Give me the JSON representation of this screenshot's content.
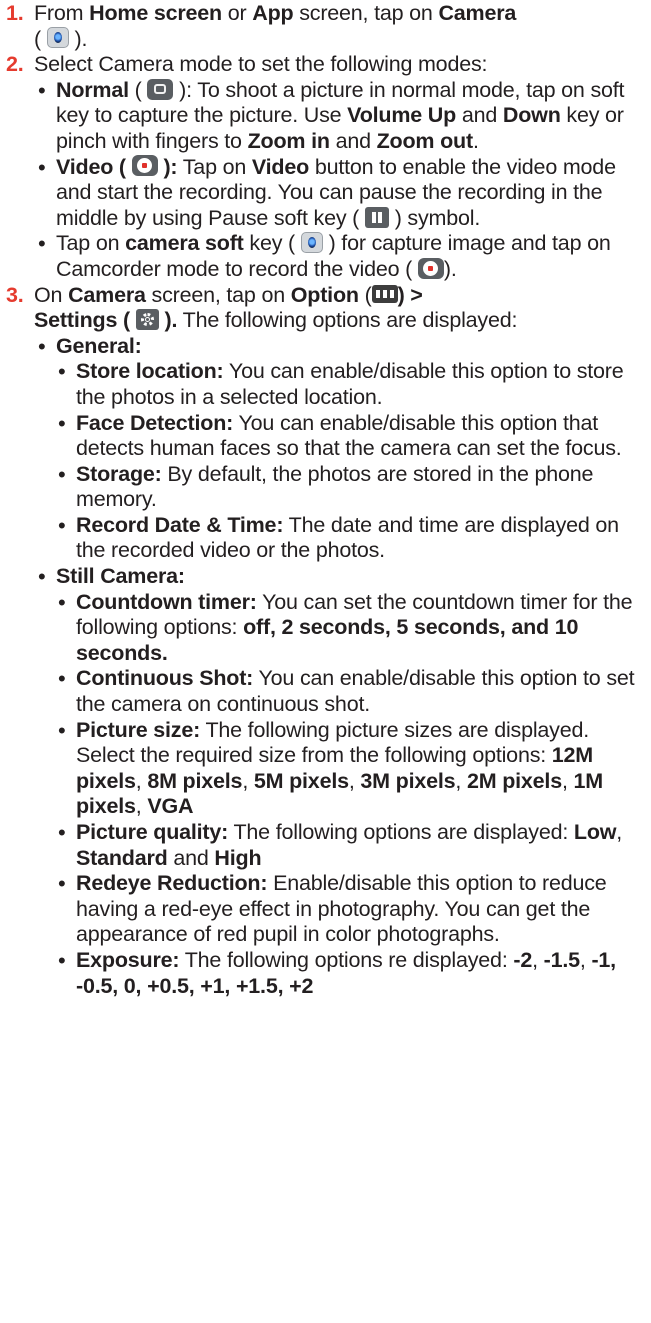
{
  "steps": [
    {
      "number": "1.",
      "p1": "From ",
      "home_screen": "Home screen",
      "p2": " or ",
      "app": "App",
      "p3": " screen, tap on ",
      "camera": "Camera",
      "p4": "(",
      "p5": ")."
    },
    {
      "number": "2.",
      "text": "Select Camera mode to set the following modes:",
      "bullets": [
        {
          "title": "Normal",
          "open": " (",
          "close": "): To shoot a picture in normal mode, tap on soft key to capture the picture. Use ",
          "volume_up": "Volume Up",
          "and": " and ",
          "down": "Down",
          "mid": " key or pinch with fingers to ",
          "zoom_in": "Zoom in",
          "and2": " and ",
          "zoom_out": "Zoom out",
          "end": "."
        },
        {
          "title": "Video (",
          "title_close": "):",
          "p1": " Tap on ",
          "video": "Video",
          "p2": " button to enable the video mode and start the recording. You can pause the recording in the middle by using Pause soft key (",
          "p3": ") symbol."
        },
        {
          "p1": "Tap on ",
          "camera_soft": "camera soft",
          "p2": " key (",
          "p3": ") for capture image and tap on Camcorder mode to record the video (",
          "p4": ")."
        }
      ]
    },
    {
      "number": "3.",
      "p1": "On ",
      "camera": "Camera",
      "p2": " screen, tap on ",
      "option": "Option",
      "p3": " (",
      "p4": ") >",
      "settings": "Settings (",
      "settings_close": ").",
      "p5": " The following options are displayed:",
      "sections": [
        {
          "title": "General:",
          "items": [
            {
              "label": "Store location:",
              "text": " You can enable/disable this option to store the photos in a selected location."
            },
            {
              "label": "Face Detection:",
              "text": " You can enable/disable this option that detects human faces so that the camera can set the focus."
            },
            {
              "label": "Storage:",
              "text": " By default, the photos are stored in the phone memory."
            },
            {
              "label": "Record Date & Time:",
              "text": " The date and time are displayed on the recorded video or the photos."
            }
          ]
        },
        {
          "title": "Still Camera:",
          "countdown": {
            "label": "Countdown timer:",
            "text": " You can set the countdown timer for the following options: ",
            "options": "off, 2 seconds, 5 seconds, and 10 seconds."
          },
          "continuous": {
            "label": "Continuous Shot:",
            "text": " You can enable/disable this option to set the camera on continuous shot."
          },
          "picture_size": {
            "label": "Picture size:",
            "text": " The following picture sizes are displayed. Select the required size from the following options: ",
            "sizes": [
              "12M pixels",
              "8M pixels",
              "5M pixels",
              "3M pixels",
              "2M pixels",
              "1M pixels",
              "VGA"
            ],
            "sep": ", "
          },
          "picture_quality": {
            "label": "Picture quality:",
            "text": " The following options are displayed: ",
            "low": "Low",
            "sep1": ", ",
            "standard": "Standard",
            "and": " and ",
            "high": "High"
          },
          "redeye": {
            "label": "Redeye Reduction:",
            "text": " Enable/disable this option to reduce having a red-eye effect in photography. You can get the appearance of red pupil in color photographs."
          },
          "exposure": {
            "label": "Exposure:",
            "text": " The following options re displayed: ",
            "v1": "-2",
            "sep": ", ",
            "v2": "-1.5",
            "v3": "-1, -0.5, 0, +0.5, +1, +1.5, +2"
          }
        }
      ]
    }
  ],
  "icons": {
    "camera": "camera-app-icon",
    "normal": "photo-camera-icon",
    "video": "record-icon",
    "pause": "pause-icon",
    "option": "option-menu-icon",
    "settings": "gear-icon"
  },
  "colors": {
    "step_number": "#e53b2e",
    "text": "#231f20"
  }
}
